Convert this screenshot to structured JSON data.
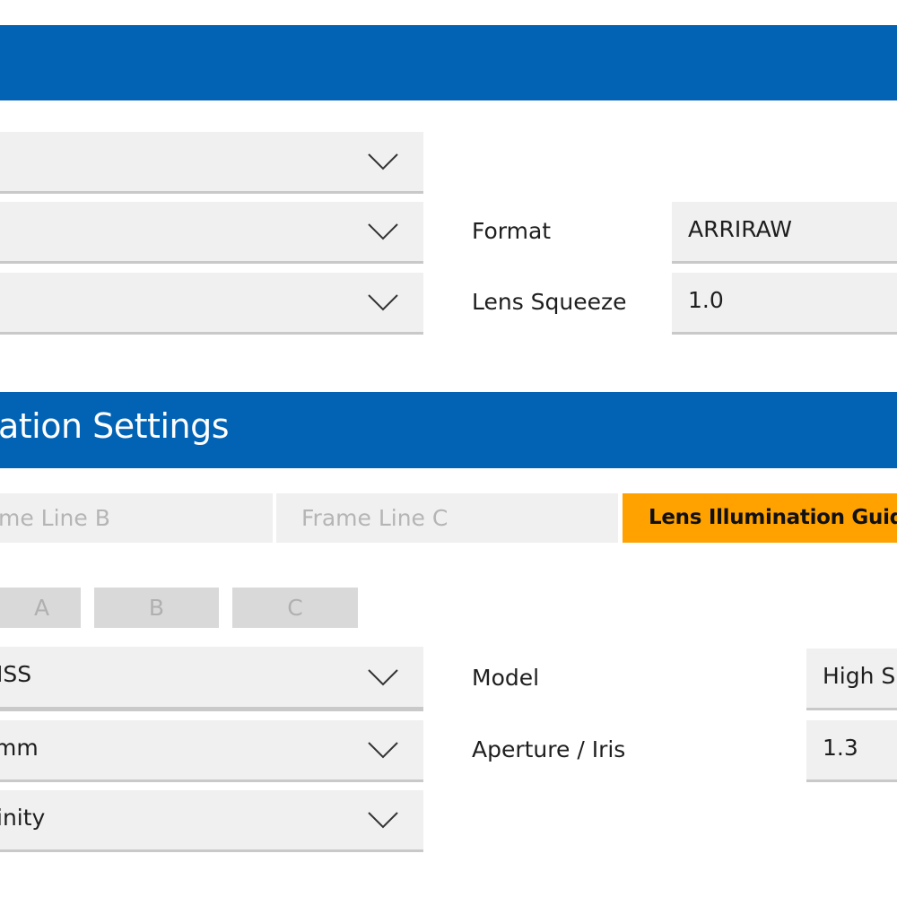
{
  "sections": {
    "top_header": {
      "title": ""
    },
    "illumination_header": {
      "title": "ation Settings"
    }
  },
  "sensor_selects": [
    {
      "value": ""
    },
    {
      "value": ""
    },
    {
      "value": ""
    }
  ],
  "format": {
    "label": "Format",
    "value": "ARRIRAW"
  },
  "lens_squeeze": {
    "label": "Lens Squeeze",
    "value": "1.0"
  },
  "tabs": [
    {
      "label": "me Line B",
      "active": false
    },
    {
      "label": "Frame Line C",
      "active": false
    },
    {
      "label": "Lens Illumination Guide",
      "active": true
    }
  ],
  "frame_line_buttons": [
    "A",
    "B",
    "C"
  ],
  "lens_selects": [
    {
      "value": "ISS"
    },
    {
      "value": " mm"
    },
    {
      "value": "inity"
    }
  ],
  "model": {
    "label": "Model",
    "value": "High Sp"
  },
  "aperture": {
    "label": "Aperture / Iris",
    "value": "1.3"
  },
  "colors": {
    "header_blue": "#0262b3",
    "active_tab": "#ffa200",
    "field_bg": "#f0f0f0",
    "field_border": "#c9c9c9",
    "mini_button_bg": "#d9d9d9"
  }
}
